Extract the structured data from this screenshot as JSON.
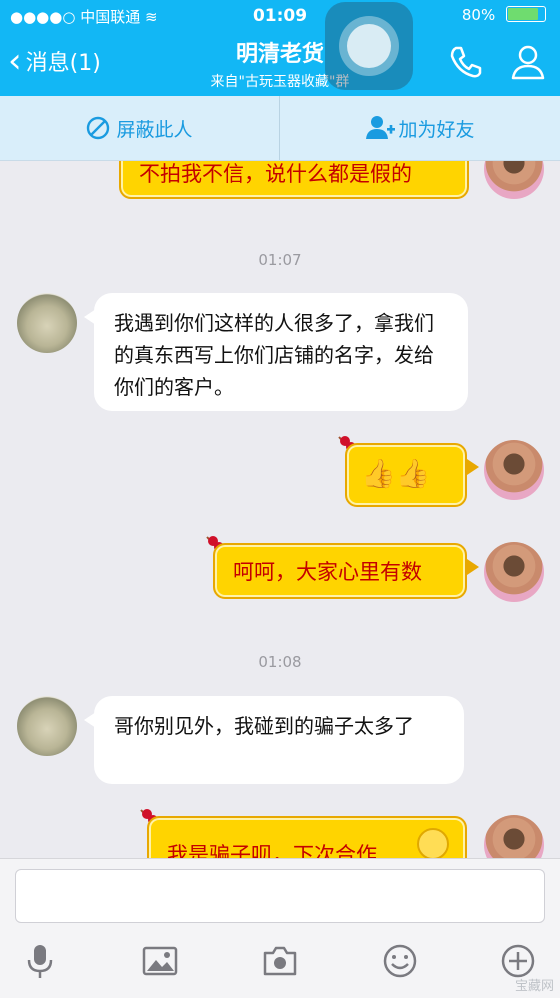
{
  "status_bar": {
    "carrier": "●●●●○ 中国联通 ≋",
    "time": "01:09",
    "battery": "80%"
  },
  "nav": {
    "back_label": "消息(1)",
    "title": "明清老货",
    "subtitle": "来自\"古玩玉器收藏\"群"
  },
  "actions": {
    "block": "屏蔽此人",
    "add_friend": "加为好友"
  },
  "messages": {
    "m1": "不拍我不信，说什么都是假的",
    "ts1": "01:07",
    "m2": "我遇到你们这样的人很多了，拿我们的真东西写上你们店铺的名字，发给你们的客户。",
    "m3": "👍👍",
    "m4": "呵呵，大家心里有数",
    "ts2": "01:08",
    "m5": "哥你别见外，我碰到的骗子太多了",
    "m6": "我是骗子呗，下次合作"
  },
  "watermark": "宝藏网",
  "colors": {
    "header_blue": "#12b7f5",
    "bubble_yellow": "#ffd400",
    "bubble_text_red": "#c40000"
  }
}
